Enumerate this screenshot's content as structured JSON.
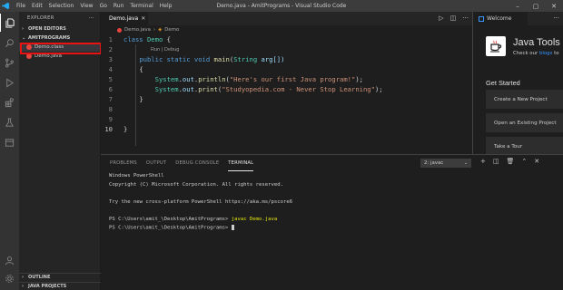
{
  "window": {
    "title": "Demo.java - AmitPrograms - Visual Studio Code",
    "menus": [
      "File",
      "Edit",
      "Selection",
      "View",
      "Go",
      "Run",
      "Terminal",
      "Help"
    ]
  },
  "sidebar": {
    "header": "EXPLORER",
    "open_editors": "OPEN EDITORS",
    "folder": "AMITPROGRAMS",
    "files": [
      "Demo.class",
      "Demo.java"
    ],
    "outline": "OUTLINE",
    "java_projects": "JAVA PROJECTS"
  },
  "editor": {
    "tab": "Demo.java",
    "breadcrumb": [
      "Demo.java",
      "Demo"
    ],
    "codelens": "Run | Debug",
    "line_numbers": [
      "1",
      "2",
      "3",
      "4",
      "5",
      "6",
      "7",
      "8",
      "9",
      "10"
    ],
    "code": {
      "l1_kw": "class",
      "l1_name": "Demo",
      "l1_brace": "{",
      "l3_public": "public",
      "l3_static": "static",
      "l3_void": "void",
      "l3_main": "main",
      "l3_string": "String",
      "l3_arg": "arg[])",
      "l4": "{",
      "l5_sys": "System",
      "l5_out": "out",
      "l5_fn": "println",
      "l5_str": "\"Here's our first Java program!\"",
      "l6_sys": "System",
      "l6_out": "out",
      "l6_fn": "print",
      "l6_str": "\"Studyopedia.com - Never Stop Learning\"",
      "l7": "}",
      "l10": "}"
    }
  },
  "welcome": {
    "tab": "Welcome",
    "title": "Java Tools",
    "subtitle_pre": "Check our ",
    "subtitle_link": "blogs",
    "subtitle_post": " to",
    "get_started": "Get Started",
    "buttons": [
      "Create a New Project",
      "Open an Existing Project",
      "Take a Tour"
    ]
  },
  "panel": {
    "tabs": [
      "PROBLEMS",
      "OUTPUT",
      "DEBUG CONSOLE",
      "TERMINAL"
    ],
    "active_tab": "TERMINAL",
    "terminal_select": "2: javac",
    "terminal_lines": [
      "Windows PowerShell",
      "Copyright (C) Microsoft Corporation. All rights reserved.",
      "",
      "Try the new cross-platform PowerShell https://aka.ms/pscore6",
      ""
    ],
    "prompt1": "PS C:\\Users\\amit_\\Desktop\\AmitPrograms> ",
    "cmd1": "javac Demo.java",
    "prompt2": "PS C:\\Users\\amit_\\Desktop\\AmitPrograms> "
  },
  "colors": {
    "accent": "#007acc",
    "highlight": "#e81414",
    "java_icon": "#e8453c"
  }
}
